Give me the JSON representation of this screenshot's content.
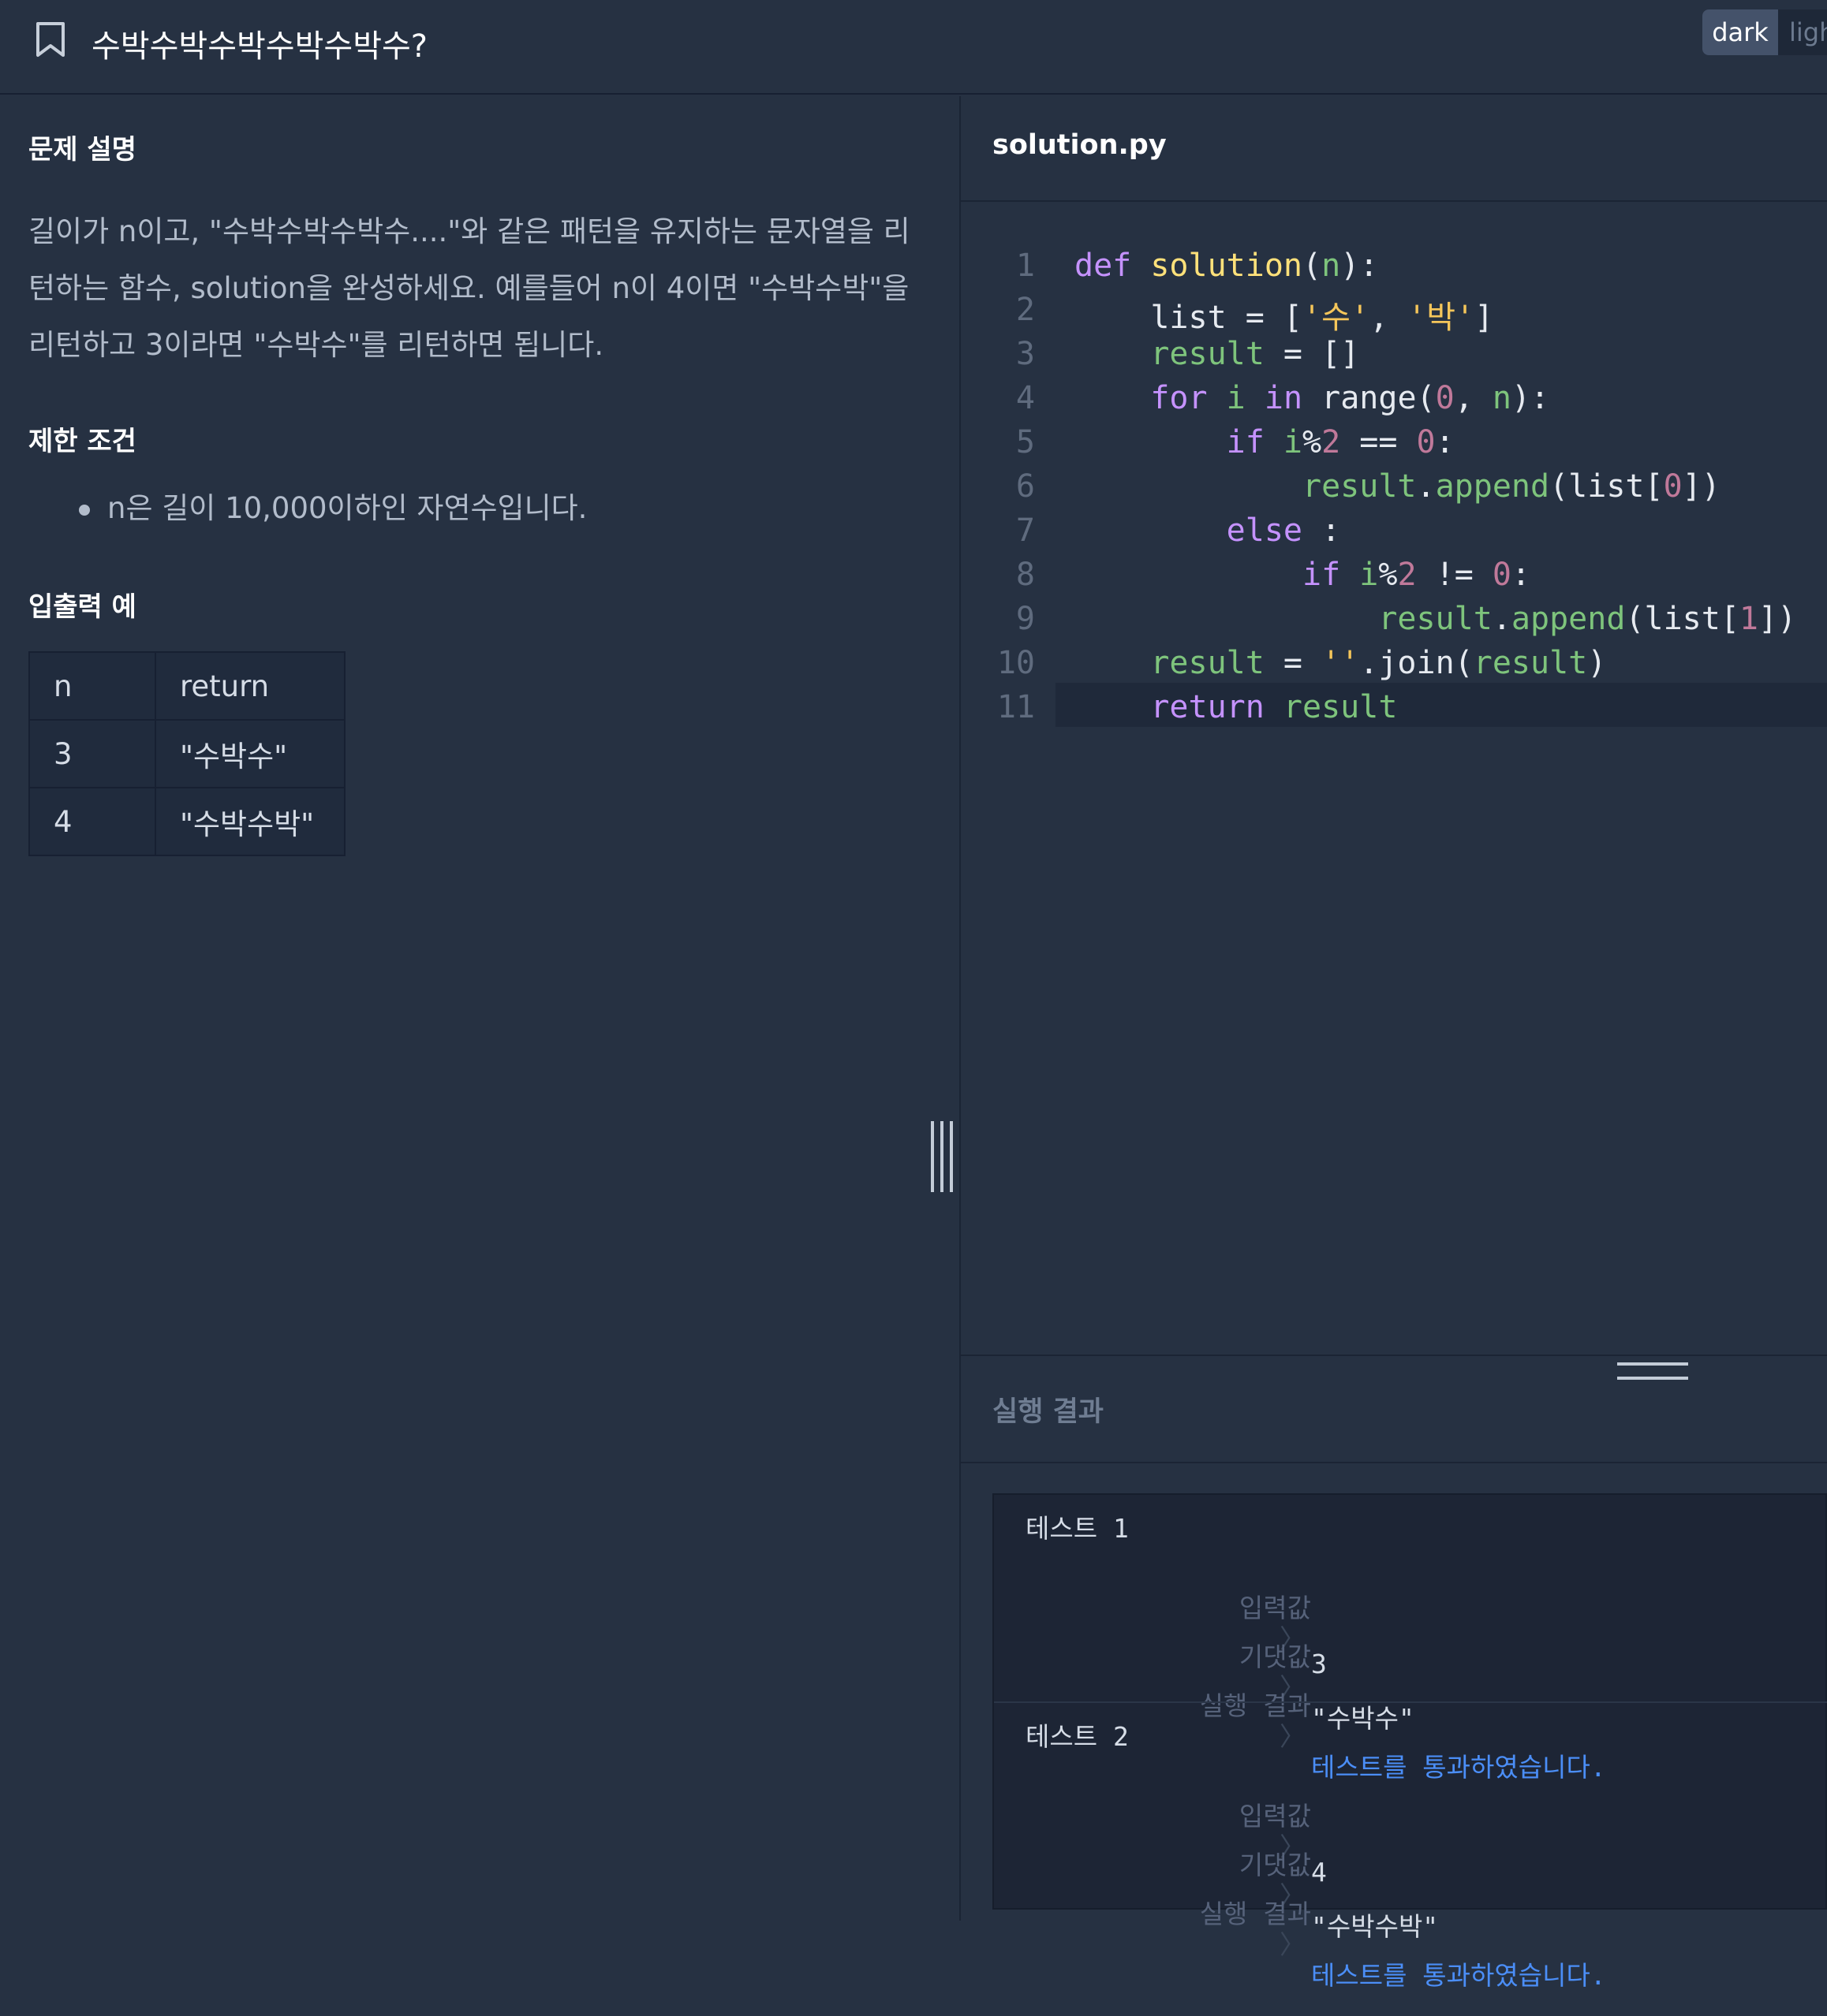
{
  "header": {
    "title": "수박수박수박수박수박수?",
    "theme_dark": "dark",
    "theme_light": "ligh"
  },
  "problem": {
    "section_description": "문제 설명",
    "description": "길이가 n이고, \"수박수박수박수....\"와 같은 패턴을 유지하는 문자열을 리턴하는 함수, solution을 완성하세요. 예를들어 n이 4이면 \"수박수박\"을 리턴하고 3이라면 \"수박수\"를 리턴하면 됩니다.",
    "section_constraints": "제한 조건",
    "constraints": [
      "n은 길이 10,000이하인 자연수입니다."
    ],
    "section_examples": "입출력 예",
    "table": {
      "headers": [
        "n",
        "return"
      ],
      "rows": [
        [
          "3",
          "\"수박수\""
        ],
        [
          "4",
          "\"수박수박\""
        ]
      ]
    }
  },
  "editor": {
    "filename": "solution.py",
    "line_numbers": [
      "1",
      "2",
      "3",
      "4",
      "5",
      "6",
      "7",
      "8",
      "9",
      "10",
      "11"
    ],
    "active_line": 11
  },
  "results": {
    "title": "실행 결과",
    "input_label": "입력값",
    "expected_label": "기댓값",
    "result_label": "실행 결과",
    "separator": "〉",
    "tests": [
      {
        "name": "테스트 1",
        "input": "3",
        "expected": "\"수박수\"",
        "result": "테스트를 통과하였습니다."
      },
      {
        "name": "테스트 2",
        "input": "4",
        "expected": "\"수박수박\"",
        "result": "테스트를 통과하였습니다."
      }
    ]
  },
  "colors": {
    "background": "#263142",
    "keyword": "#c592ff",
    "function": "#ffe17a",
    "variable": "#7ec47c",
    "string": "#f5c65a",
    "number": "#c0799a",
    "pass": "#4b8ef7"
  },
  "icons": {
    "bookmark": "bookmark-icon",
    "vertical_resize": "vertical-resize-handle-icon",
    "horizontal_resize": "horizontal-resize-handle-icon"
  }
}
